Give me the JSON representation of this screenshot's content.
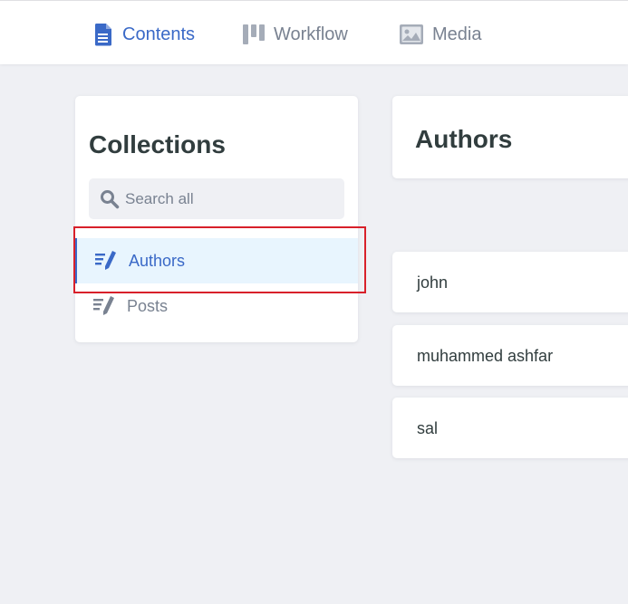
{
  "nav": {
    "items": [
      {
        "label": "Contents",
        "icon": "document-icon",
        "active": true
      },
      {
        "label": "Workflow",
        "icon": "kanban-icon",
        "active": false
      },
      {
        "label": "Media",
        "icon": "image-icon",
        "active": false
      }
    ]
  },
  "sidebar": {
    "title": "Collections",
    "search_placeholder": "Search all",
    "collections": [
      {
        "label": "Authors",
        "icon": "write-icon",
        "active": true
      },
      {
        "label": "Posts",
        "icon": "write-icon",
        "active": false
      }
    ]
  },
  "main": {
    "title": "Authors",
    "entries": [
      {
        "label": "john"
      },
      {
        "label": "muhammed ashfar"
      },
      {
        "label": "sal"
      }
    ]
  },
  "colors": {
    "accent": "#3a69c7",
    "active_bg": "#e8f5fe",
    "page_bg": "#eff0f4",
    "highlight": "#d8202a",
    "muted": "#798291"
  }
}
